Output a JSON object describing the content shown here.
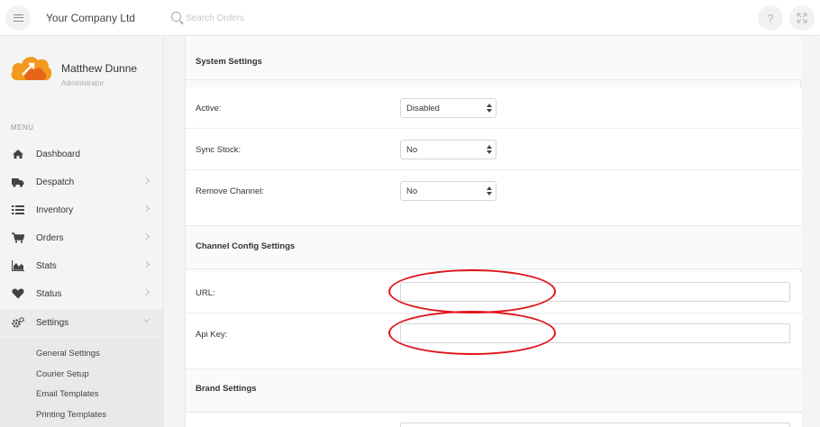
{
  "header": {
    "company_name": "Your Company Ltd",
    "search_placeholder": "Search Orders",
    "help_label": "?"
  },
  "profile": {
    "name": "Matthew Dunne",
    "role": "Administrator"
  },
  "sidebar": {
    "menu_label": "MENU",
    "items": [
      {
        "label": "Dashboard",
        "icon": "home-icon"
      },
      {
        "label": "Despatch",
        "icon": "truck-icon"
      },
      {
        "label": "Inventory",
        "icon": "list-icon"
      },
      {
        "label": "Orders",
        "icon": "cart-icon"
      },
      {
        "label": "Stats",
        "icon": "area-chart-icon"
      },
      {
        "label": "Status",
        "icon": "heart-icon"
      },
      {
        "label": "Settings",
        "icon": "cogs-icon"
      }
    ],
    "submenu": [
      "General Settings",
      "Courier Setup",
      "Email Templates",
      "Printing Templates"
    ]
  },
  "main": {
    "system_settings": {
      "title": "System Settings",
      "active_label": "Active:",
      "active_value": "Disabled",
      "sync_stock_label": "Sync Stock:",
      "sync_stock_value": "No",
      "remove_channel_label": "Remove Channel:",
      "remove_channel_value": "No"
    },
    "channel_config": {
      "title": "Channel Config Settings",
      "url_label": "URL:",
      "url_value": "",
      "api_key_label": "Api Key:",
      "api_key_value": ""
    },
    "brand_settings": {
      "title": "Brand Settings"
    }
  },
  "colors": {
    "annotation": "#e0141b",
    "logo_orange": "#f39a1e",
    "logo_dark_orange": "#e8641b"
  }
}
